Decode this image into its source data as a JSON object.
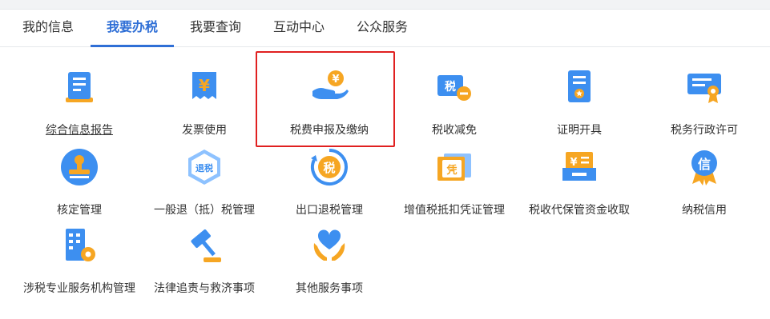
{
  "tabs": [
    {
      "label": "我的信息",
      "active": false
    },
    {
      "label": "我要办税",
      "active": true
    },
    {
      "label": "我要查询",
      "active": false
    },
    {
      "label": "互动中心",
      "active": false
    },
    {
      "label": "公众服务",
      "active": false
    }
  ],
  "tiles": [
    {
      "label": "综合信息报告",
      "icon": "report-doc-icon"
    },
    {
      "label": "发票使用",
      "icon": "invoice-yen-icon"
    },
    {
      "label": "税费申报及缴纳",
      "icon": "hand-coin-icon"
    },
    {
      "label": "税收减免",
      "icon": "tax-reduction-icon"
    },
    {
      "label": "证明开具",
      "icon": "certificate-icon"
    },
    {
      "label": "税务行政许可",
      "icon": "license-award-icon"
    },
    {
      "label": "核定管理",
      "icon": "stamp-icon"
    },
    {
      "label": "一般退（抵）税管理",
      "icon": "tax-refund-hexagon-icon"
    },
    {
      "label": "出口退税管理",
      "icon": "export-refund-icon"
    },
    {
      "label": "增值税抵扣凭证管理",
      "icon": "voucher-ticket-icon"
    },
    {
      "label": "税收代保管资金收取",
      "icon": "cash-tray-icon"
    },
    {
      "label": "纳税信用",
      "icon": "credit-medal-icon"
    },
    {
      "label": "涉税专业服务机构管理",
      "icon": "building-gear-icon"
    },
    {
      "label": "法律追责与救济事项",
      "icon": "gavel-icon"
    },
    {
      "label": "其他服务事项",
      "icon": "heart-hands-icon"
    }
  ],
  "icon_glyphs": {
    "invoice": "¥",
    "coin": "¥",
    "reduction": "税",
    "stamp": "",
    "refund": "退税",
    "export": "税",
    "voucher": "凭",
    "cash": "¥",
    "credit": "信"
  },
  "colors": {
    "accent": "#2f6fd6",
    "icon_blue": "#3d8ff0",
    "icon_light": "#8ec2ff",
    "icon_orange": "#f6a623",
    "highlight": "#e02020"
  }
}
